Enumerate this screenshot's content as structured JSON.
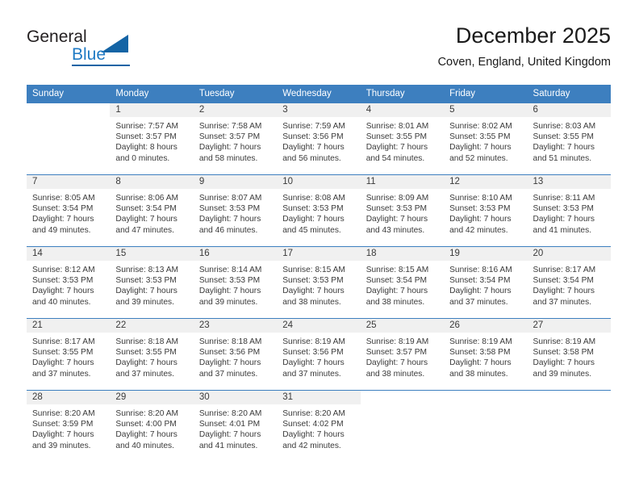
{
  "brand": {
    "name_part1": "General",
    "name_part2": "Blue",
    "logo_icon": "triangle-icon",
    "accent_color": "#1464a5"
  },
  "header": {
    "title": "December 2025",
    "subtitle": "Coven, England, United Kingdom"
  },
  "calendar": {
    "header_bg_color": "#3d7fbf",
    "weekday_headers": [
      "Sunday",
      "Monday",
      "Tuesday",
      "Wednesday",
      "Thursday",
      "Friday",
      "Saturday"
    ],
    "weeks": [
      [
        {
          "day": "",
          "sunrise": "",
          "sunset": "",
          "daylight_line1": "",
          "daylight_line2": ""
        },
        {
          "day": "1",
          "sunrise": "Sunrise: 7:57 AM",
          "sunset": "Sunset: 3:57 PM",
          "daylight_line1": "Daylight: 8 hours",
          "daylight_line2": "and 0 minutes."
        },
        {
          "day": "2",
          "sunrise": "Sunrise: 7:58 AM",
          "sunset": "Sunset: 3:57 PM",
          "daylight_line1": "Daylight: 7 hours",
          "daylight_line2": "and 58 minutes."
        },
        {
          "day": "3",
          "sunrise": "Sunrise: 7:59 AM",
          "sunset": "Sunset: 3:56 PM",
          "daylight_line1": "Daylight: 7 hours",
          "daylight_line2": "and 56 minutes."
        },
        {
          "day": "4",
          "sunrise": "Sunrise: 8:01 AM",
          "sunset": "Sunset: 3:55 PM",
          "daylight_line1": "Daylight: 7 hours",
          "daylight_line2": "and 54 minutes."
        },
        {
          "day": "5",
          "sunrise": "Sunrise: 8:02 AM",
          "sunset": "Sunset: 3:55 PM",
          "daylight_line1": "Daylight: 7 hours",
          "daylight_line2": "and 52 minutes."
        },
        {
          "day": "6",
          "sunrise": "Sunrise: 8:03 AM",
          "sunset": "Sunset: 3:55 PM",
          "daylight_line1": "Daylight: 7 hours",
          "daylight_line2": "and 51 minutes."
        }
      ],
      [
        {
          "day": "7",
          "sunrise": "Sunrise: 8:05 AM",
          "sunset": "Sunset: 3:54 PM",
          "daylight_line1": "Daylight: 7 hours",
          "daylight_line2": "and 49 minutes."
        },
        {
          "day": "8",
          "sunrise": "Sunrise: 8:06 AM",
          "sunset": "Sunset: 3:54 PM",
          "daylight_line1": "Daylight: 7 hours",
          "daylight_line2": "and 47 minutes."
        },
        {
          "day": "9",
          "sunrise": "Sunrise: 8:07 AM",
          "sunset": "Sunset: 3:53 PM",
          "daylight_line1": "Daylight: 7 hours",
          "daylight_line2": "and 46 minutes."
        },
        {
          "day": "10",
          "sunrise": "Sunrise: 8:08 AM",
          "sunset": "Sunset: 3:53 PM",
          "daylight_line1": "Daylight: 7 hours",
          "daylight_line2": "and 45 minutes."
        },
        {
          "day": "11",
          "sunrise": "Sunrise: 8:09 AM",
          "sunset": "Sunset: 3:53 PM",
          "daylight_line1": "Daylight: 7 hours",
          "daylight_line2": "and 43 minutes."
        },
        {
          "day": "12",
          "sunrise": "Sunrise: 8:10 AM",
          "sunset": "Sunset: 3:53 PM",
          "daylight_line1": "Daylight: 7 hours",
          "daylight_line2": "and 42 minutes."
        },
        {
          "day": "13",
          "sunrise": "Sunrise: 8:11 AM",
          "sunset": "Sunset: 3:53 PM",
          "daylight_line1": "Daylight: 7 hours",
          "daylight_line2": "and 41 minutes."
        }
      ],
      [
        {
          "day": "14",
          "sunrise": "Sunrise: 8:12 AM",
          "sunset": "Sunset: 3:53 PM",
          "daylight_line1": "Daylight: 7 hours",
          "daylight_line2": "and 40 minutes."
        },
        {
          "day": "15",
          "sunrise": "Sunrise: 8:13 AM",
          "sunset": "Sunset: 3:53 PM",
          "daylight_line1": "Daylight: 7 hours",
          "daylight_line2": "and 39 minutes."
        },
        {
          "day": "16",
          "sunrise": "Sunrise: 8:14 AM",
          "sunset": "Sunset: 3:53 PM",
          "daylight_line1": "Daylight: 7 hours",
          "daylight_line2": "and 39 minutes."
        },
        {
          "day": "17",
          "sunrise": "Sunrise: 8:15 AM",
          "sunset": "Sunset: 3:53 PM",
          "daylight_line1": "Daylight: 7 hours",
          "daylight_line2": "and 38 minutes."
        },
        {
          "day": "18",
          "sunrise": "Sunrise: 8:15 AM",
          "sunset": "Sunset: 3:54 PM",
          "daylight_line1": "Daylight: 7 hours",
          "daylight_line2": "and 38 minutes."
        },
        {
          "day": "19",
          "sunrise": "Sunrise: 8:16 AM",
          "sunset": "Sunset: 3:54 PM",
          "daylight_line1": "Daylight: 7 hours",
          "daylight_line2": "and 37 minutes."
        },
        {
          "day": "20",
          "sunrise": "Sunrise: 8:17 AM",
          "sunset": "Sunset: 3:54 PM",
          "daylight_line1": "Daylight: 7 hours",
          "daylight_line2": "and 37 minutes."
        }
      ],
      [
        {
          "day": "21",
          "sunrise": "Sunrise: 8:17 AM",
          "sunset": "Sunset: 3:55 PM",
          "daylight_line1": "Daylight: 7 hours",
          "daylight_line2": "and 37 minutes."
        },
        {
          "day": "22",
          "sunrise": "Sunrise: 8:18 AM",
          "sunset": "Sunset: 3:55 PM",
          "daylight_line1": "Daylight: 7 hours",
          "daylight_line2": "and 37 minutes."
        },
        {
          "day": "23",
          "sunrise": "Sunrise: 8:18 AM",
          "sunset": "Sunset: 3:56 PM",
          "daylight_line1": "Daylight: 7 hours",
          "daylight_line2": "and 37 minutes."
        },
        {
          "day": "24",
          "sunrise": "Sunrise: 8:19 AM",
          "sunset": "Sunset: 3:56 PM",
          "daylight_line1": "Daylight: 7 hours",
          "daylight_line2": "and 37 minutes."
        },
        {
          "day": "25",
          "sunrise": "Sunrise: 8:19 AM",
          "sunset": "Sunset: 3:57 PM",
          "daylight_line1": "Daylight: 7 hours",
          "daylight_line2": "and 38 minutes."
        },
        {
          "day": "26",
          "sunrise": "Sunrise: 8:19 AM",
          "sunset": "Sunset: 3:58 PM",
          "daylight_line1": "Daylight: 7 hours",
          "daylight_line2": "and 38 minutes."
        },
        {
          "day": "27",
          "sunrise": "Sunrise: 8:19 AM",
          "sunset": "Sunset: 3:58 PM",
          "daylight_line1": "Daylight: 7 hours",
          "daylight_line2": "and 39 minutes."
        }
      ],
      [
        {
          "day": "28",
          "sunrise": "Sunrise: 8:20 AM",
          "sunset": "Sunset: 3:59 PM",
          "daylight_line1": "Daylight: 7 hours",
          "daylight_line2": "and 39 minutes."
        },
        {
          "day": "29",
          "sunrise": "Sunrise: 8:20 AM",
          "sunset": "Sunset: 4:00 PM",
          "daylight_line1": "Daylight: 7 hours",
          "daylight_line2": "and 40 minutes."
        },
        {
          "day": "30",
          "sunrise": "Sunrise: 8:20 AM",
          "sunset": "Sunset: 4:01 PM",
          "daylight_line1": "Daylight: 7 hours",
          "daylight_line2": "and 41 minutes."
        },
        {
          "day": "31",
          "sunrise": "Sunrise: 8:20 AM",
          "sunset": "Sunset: 4:02 PM",
          "daylight_line1": "Daylight: 7 hours",
          "daylight_line2": "and 42 minutes."
        },
        {
          "day": "",
          "sunrise": "",
          "sunset": "",
          "daylight_line1": "",
          "daylight_line2": ""
        },
        {
          "day": "",
          "sunrise": "",
          "sunset": "",
          "daylight_line1": "",
          "daylight_line2": ""
        },
        {
          "day": "",
          "sunrise": "",
          "sunset": "",
          "daylight_line1": "",
          "daylight_line2": ""
        }
      ]
    ]
  }
}
